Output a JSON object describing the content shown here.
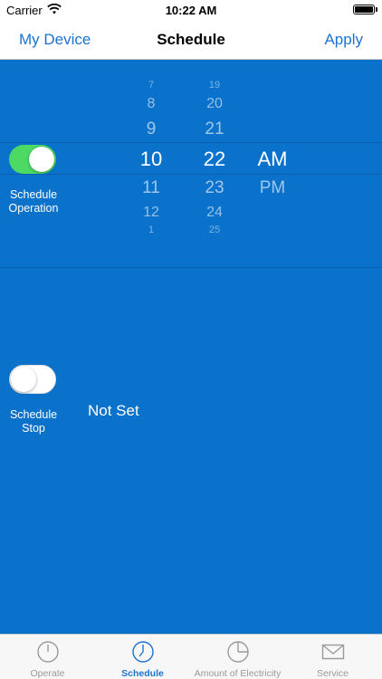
{
  "status_bar": {
    "carrier": "Carrier",
    "time": "10:22 AM"
  },
  "nav": {
    "back_label": "My Device",
    "title": "Schedule",
    "apply_label": "Apply"
  },
  "schedule_operation": {
    "label": "Schedule\nOperation",
    "enabled": true
  },
  "schedule_stop": {
    "label": "Schedule\nStop",
    "enabled": false,
    "value": "Not Set"
  },
  "picker": {
    "hours": [
      "7",
      "8",
      "9",
      "10",
      "11",
      "12",
      "1"
    ],
    "minutes": [
      "19",
      "20",
      "21",
      "22",
      "23",
      "24",
      "25"
    ],
    "periods": [
      "AM",
      "PM"
    ],
    "selected_hour": "10",
    "selected_minute": "22",
    "selected_period": "AM"
  },
  "tabs": [
    {
      "label": "Operate",
      "icon": "power-icon",
      "active": false
    },
    {
      "label": "Schedule",
      "icon": "clock-icon",
      "active": true
    },
    {
      "label": "Amount of Electricity",
      "icon": "pie-chart-icon",
      "active": false
    },
    {
      "label": "Service",
      "icon": "mail-icon",
      "active": false
    }
  ],
  "colors": {
    "accent": "#1a73d1",
    "background": "#0b72cc",
    "toggle_on": "#4cd964"
  }
}
